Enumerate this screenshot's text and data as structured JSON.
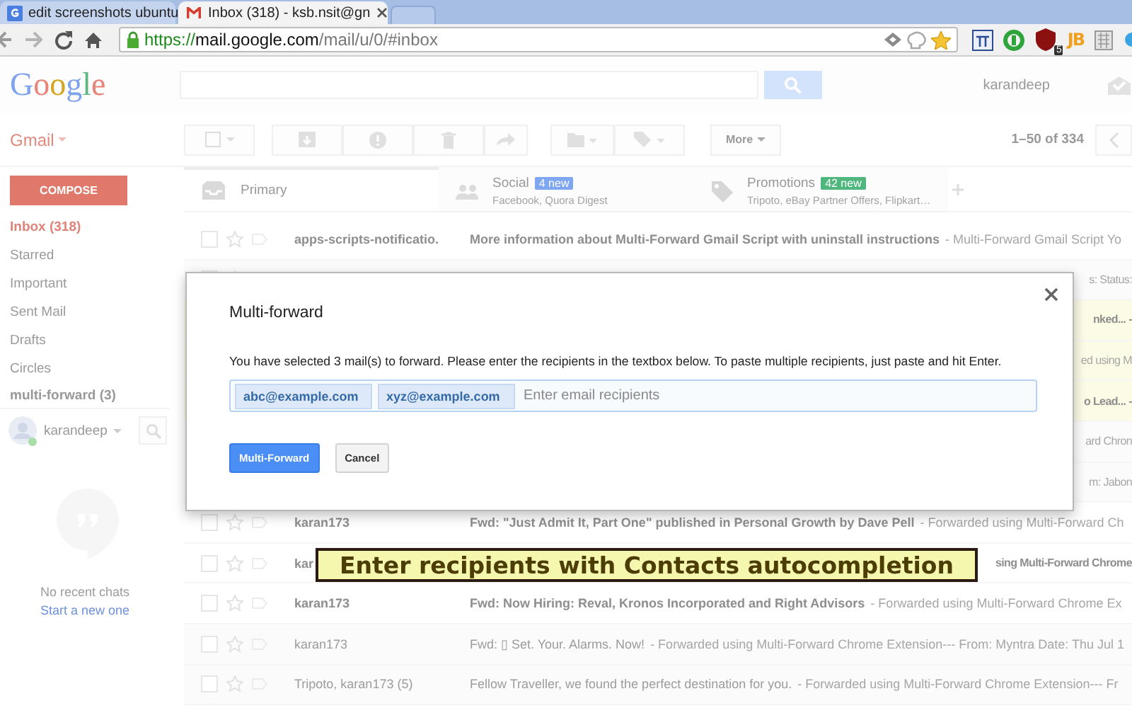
{
  "browser": {
    "tabs": [
      {
        "title": "edit screenshots ubuntu",
        "selected": false
      },
      {
        "title": "Inbox (318) - ksb.nsit@gn",
        "selected": true
      }
    ],
    "url": {
      "scheme": "https://",
      "host": "mail.google.com",
      "path": "/mail/u/0/#inbox"
    },
    "extension_badge": "5",
    "extension_text": "JB"
  },
  "header": {
    "logo": "Google",
    "account": "karandeep"
  },
  "toolbar": {
    "app_menu": "Gmail",
    "more": "More",
    "pagination": "1–50 of 334"
  },
  "sidebar": {
    "compose": "COMPOSE",
    "items": [
      {
        "label": "Inbox (318)",
        "selected": true
      },
      {
        "label": "Starred",
        "selected": false
      },
      {
        "label": "Important",
        "selected": false
      },
      {
        "label": "Sent Mail",
        "selected": false
      },
      {
        "label": "Drafts",
        "selected": false
      },
      {
        "label": "Circles",
        "selected": false
      }
    ],
    "label_section": "multi-forward (3)",
    "user": "karandeep",
    "chat_empty": "No recent chats",
    "chat_link": "Start a new one"
  },
  "inbox_tabs": [
    {
      "label": "Primary",
      "selected": true
    },
    {
      "label": "Social",
      "badge": "4 new",
      "color": "#7fa6f0",
      "subtitle": "Facebook, Quora Digest",
      "selected": false
    },
    {
      "label": "Promotions",
      "badge": "42 new",
      "color": "#4fb67e",
      "subtitle": "Tripoto, eBay Partner Offers, Flipkart…",
      "selected": false
    }
  ],
  "messages": [
    {
      "sender": "apps-scripts-notificatio.",
      "subject": "More information about Multi-Forward Gmail Script with uninstall instructions",
      "snippet": "- Multi-Forward Gmail Script Yo",
      "unread": true,
      "selected": false
    },
    {
      "tail": "s: Status:",
      "unread": false,
      "selected": false
    },
    {
      "tail": "nked... -",
      "unread": true,
      "selected": true
    },
    {
      "tail": "ed using M",
      "unread": false,
      "selected": true
    },
    {
      "tail": "o Lead... -",
      "unread": true,
      "selected": true
    },
    {
      "tail": "ard Chron",
      "unread": false,
      "selected": false
    },
    {
      "tail": "m: Jabon",
      "unread": false,
      "selected": false
    },
    {
      "sender": "karan173",
      "subject": "Fwd: \"Just Admit It, Part One\" published in Personal Growth by Dave Pell",
      "snippet": "- Forwarded using Multi-Forward Ch",
      "unread": true,
      "selected": false
    },
    {
      "sender": "kar",
      "tail": "sing Multi-Forward Chrome",
      "unread": true,
      "selected": false
    },
    {
      "sender": "karan173",
      "subject": "Fwd: Now Hiring: Reval, Kronos Incorporated and Right Advisors",
      "snippet": "- Forwarded using Multi-Forward Chrome Ex",
      "unread": true,
      "selected": false
    },
    {
      "sender": "karan173",
      "subject": "Fwd: ▯ Set. Your. Alarms. Now!",
      "snippet": "- Forwarded using Multi-Forward Chrome Extension--- From: Myntra Date: Thu Jul 1",
      "unread": false,
      "selected": false
    },
    {
      "sender": "Tripoto, karan173 (5)",
      "subject": "Fellow Traveller, we found the perfect destination for you.",
      "snippet": "- Forwarded using Multi-Forward Chrome Extension--- Fr",
      "unread": false,
      "selected": false
    }
  ],
  "dialog": {
    "title": "Multi-forward",
    "message": "You have selected 3 mail(s) to forward. Please enter the recipients in the textbox below. To paste multiple recipients, just paste and hit Enter.",
    "recipients": [
      "abc@example.com",
      "xyz@example.com"
    ],
    "placeholder": "Enter email recipients",
    "buttons": [
      {
        "label": "Multi-Forward",
        "kind": "primary"
      },
      {
        "label": "Cancel",
        "kind": "secondary"
      }
    ]
  },
  "banner": {
    "text": "Enter recipients with Contacts autocompletion"
  }
}
